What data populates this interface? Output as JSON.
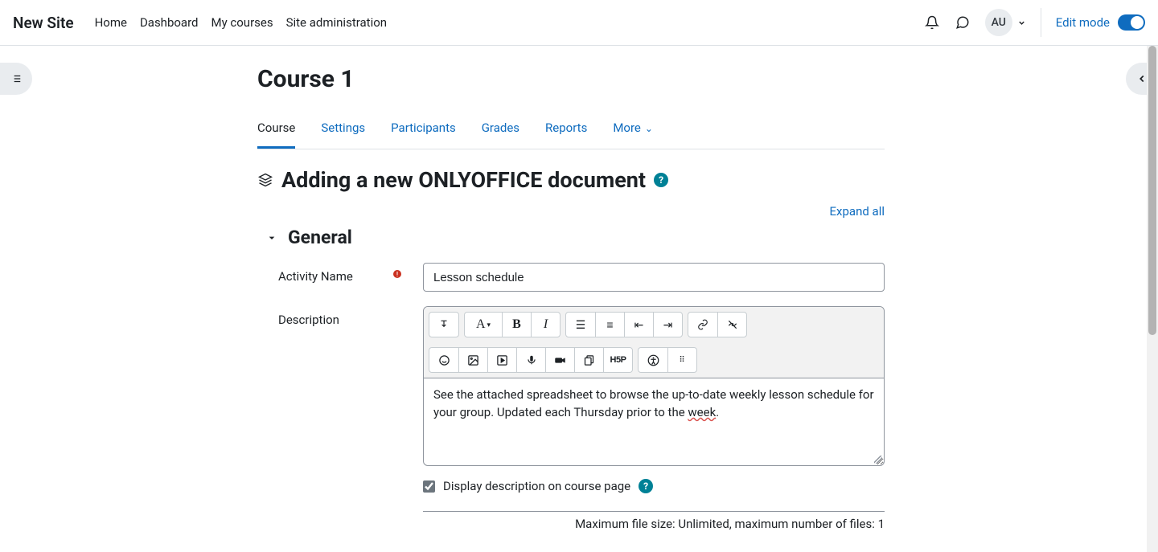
{
  "header": {
    "brand": "New Site",
    "nav": [
      "Home",
      "Dashboard",
      "My courses",
      "Site administration"
    ],
    "user_initials": "AU",
    "edit_mode_label": "Edit mode"
  },
  "page": {
    "course_title": "Course 1",
    "tabs": [
      "Course",
      "Settings",
      "Participants",
      "Grades",
      "Reports",
      "More"
    ],
    "active_tab_index": 0,
    "subtitle": "Adding a new ONLYOFFICE document",
    "expand_all": "Expand all",
    "section_general": "General"
  },
  "form": {
    "activity_name_label": "Activity Name",
    "activity_name_value": "Lesson schedule",
    "description_label": "Description",
    "description_value_part1": "See the attached spreadsheet to browse the up-to-date weekly lesson schedule for your group. Updated each Thursday prior to the ",
    "description_value_underlined": "week",
    "description_value_part2": ".",
    "display_desc_label": "Display description on course page",
    "display_desc_checked": true,
    "file_limits": "Maximum file size: Unlimited, maximum number of files: 1"
  },
  "icons": {
    "help": "?",
    "chevron_down": "⌄"
  }
}
